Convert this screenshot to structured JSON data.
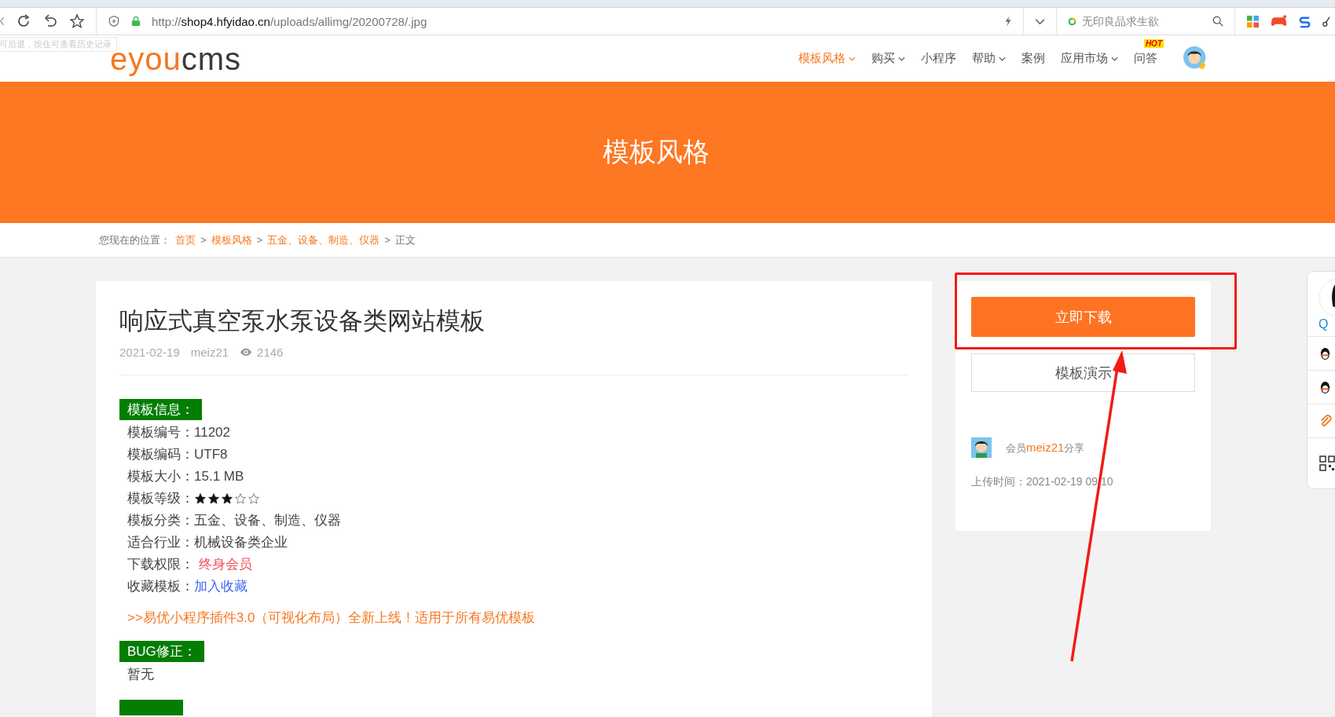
{
  "browser": {
    "url_scheme": "http://",
    "url_host": "shop4.hfyidao.cn",
    "url_path": "/uploads/allimg/20200728/.jpg",
    "search_placeholder": "无印良品求生欲",
    "tooltip": "可后退，按住可查看历史记录"
  },
  "header": {
    "logo_accent": "eyou",
    "logo_rest": "cms",
    "nav": [
      {
        "label": "模板风格",
        "selected": true,
        "dropdown": true
      },
      {
        "label": "购买",
        "selected": false,
        "dropdown": true
      },
      {
        "label": "小程序",
        "selected": false,
        "dropdown": false
      },
      {
        "label": "帮助",
        "selected": false,
        "dropdown": true
      },
      {
        "label": "案例",
        "selected": false,
        "dropdown": false
      },
      {
        "label": "应用市场",
        "selected": false,
        "dropdown": true
      },
      {
        "label": "问答",
        "selected": false,
        "dropdown": false,
        "badge": "HOT"
      }
    ]
  },
  "banner": {
    "title": "模板风格"
  },
  "breadcrumb": {
    "prefix": "您现在的位置：",
    "links": [
      "首页",
      "模板风格",
      "五金、设备、制造、仪器"
    ],
    "current": "正文",
    "separator": ">"
  },
  "article": {
    "title": "响应式真空泵水泵设备类网站模板",
    "date": "2021-02-19",
    "author": "meiz21",
    "views": "2146",
    "sections": [
      {
        "heading": "模板信息：",
        "rows": [
          {
            "label": "模板编号：",
            "kind": "text",
            "value": "11202"
          },
          {
            "label": "模板编码：",
            "kind": "text",
            "value": "UTF8"
          },
          {
            "label": "模板大小：",
            "kind": "text",
            "value": "15.1 MB"
          },
          {
            "label": "模板等级：",
            "kind": "stars",
            "stars": 3
          },
          {
            "label": "模板分类：",
            "kind": "text",
            "value": "五金、设备、制造、仪器"
          },
          {
            "label": "适合行业：",
            "kind": "text",
            "value": "机械设备类企业"
          },
          {
            "label": "下载权限：",
            "kind": "red",
            "value": "终身会员"
          },
          {
            "label": "收藏模板：",
            "kind": "link",
            "value": "加入收藏"
          }
        ],
        "promo": ">>易优小程序插件3.0（可视化布局）全新上线！适用于所有易优模板"
      },
      {
        "heading": "BUG修正：",
        "rows": [
          {
            "label": "",
            "kind": "text",
            "value": "暂无"
          }
        ]
      }
    ]
  },
  "side": {
    "download": "立即下载",
    "demo": "模板演示",
    "share_prefix": "会员",
    "share_user": "meiz21",
    "share_suffix": "分享",
    "upload_time": "上传时间：2021-02-19 09:10"
  },
  "float_bar": {
    "qq_label": "Q"
  }
}
